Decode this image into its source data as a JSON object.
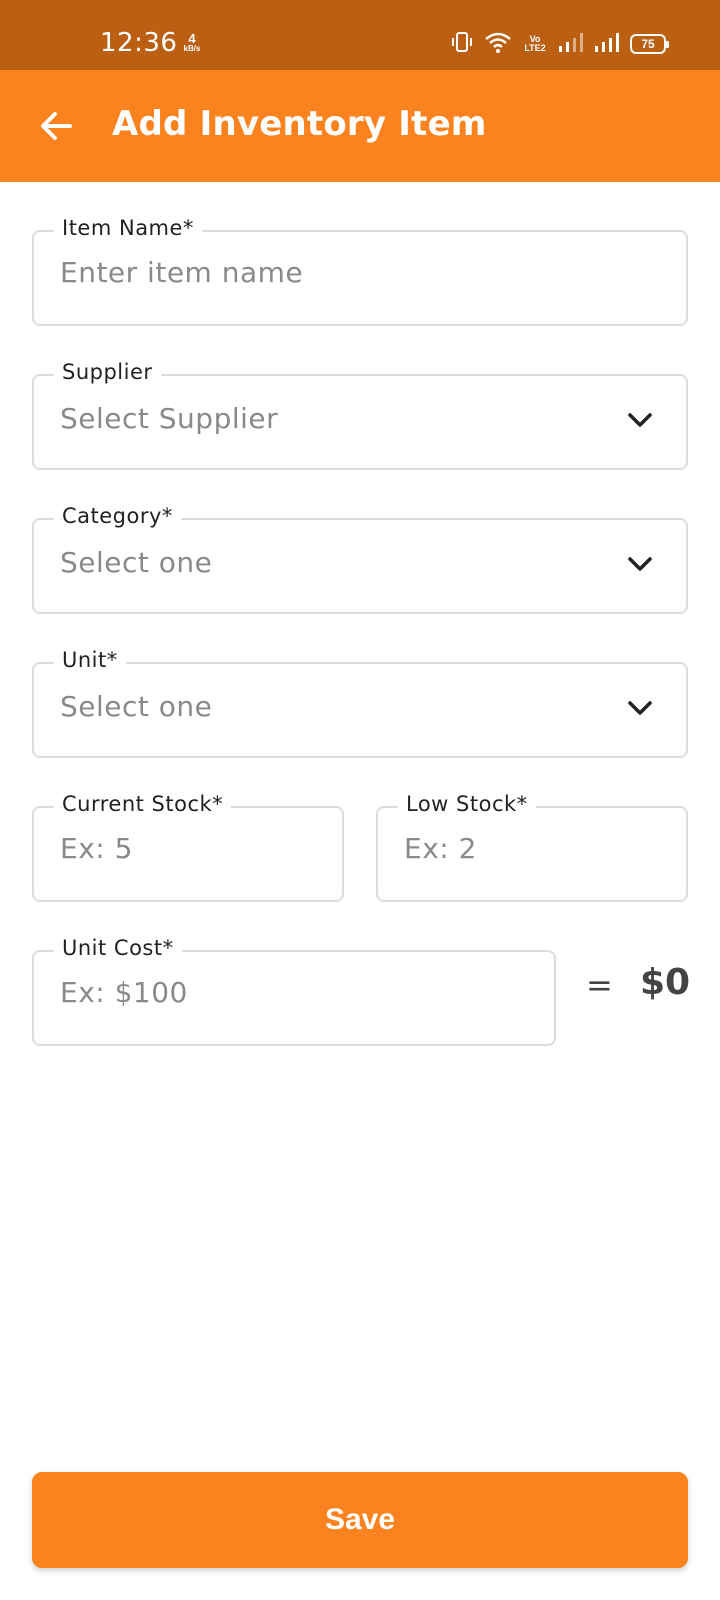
{
  "status_bar": {
    "time": "12:36",
    "net_speed_value": "4",
    "net_speed_unit": "kB/s",
    "volte_top": "Vo",
    "volte_bottom": "LTE2",
    "battery": "75",
    "icons": [
      "vibrate-icon",
      "wifi-icon",
      "volte-icon",
      "signal-1-icon",
      "signal-2-icon",
      "battery-icon"
    ]
  },
  "app_bar": {
    "title": "Add Inventory Item",
    "back_icon": "arrow-left-icon",
    "background": "#fb831f"
  },
  "form": {
    "item_name": {
      "label": "Item Name*",
      "placeholder": "Enter item name"
    },
    "supplier": {
      "label": "Supplier",
      "value": "Select Supplier"
    },
    "category": {
      "label": "Category*",
      "value": "Select one"
    },
    "unit": {
      "label": "Unit*",
      "value": "Select one"
    },
    "current_stock": {
      "label": "Current Stock*",
      "placeholder": "Ex: 5"
    },
    "low_stock": {
      "label": "Low Stock*",
      "placeholder": "Ex: 2"
    },
    "unit_cost": {
      "label": "Unit Cost*",
      "placeholder": "Ex: $100"
    },
    "equals": "=",
    "total": "$0"
  },
  "actions": {
    "save_label": "Save"
  },
  "colors": {
    "status_bar": "#bb5f13",
    "accent": "#fb831f",
    "border": "#dcdcdc",
    "placeholder": "#8a8a8a"
  }
}
